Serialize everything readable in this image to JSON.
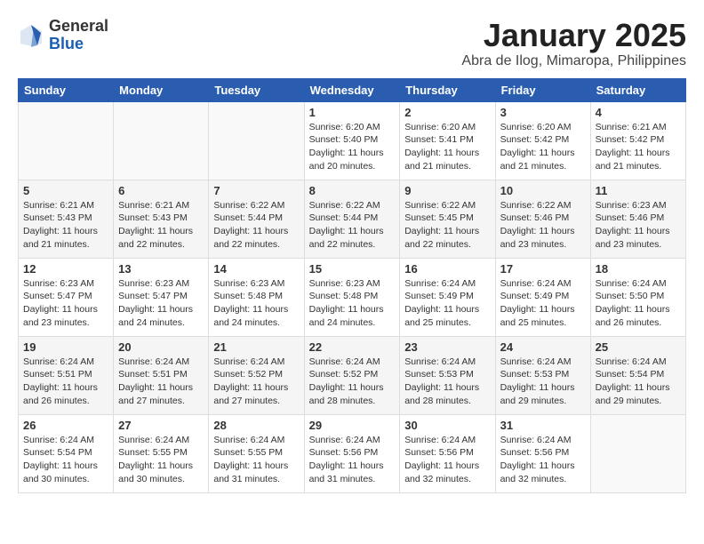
{
  "logo": {
    "general": "General",
    "blue": "Blue"
  },
  "title": "January 2025",
  "subtitle": "Abra de Ilog, Mimaropa, Philippines",
  "days_of_week": [
    "Sunday",
    "Monday",
    "Tuesday",
    "Wednesday",
    "Thursday",
    "Friday",
    "Saturday"
  ],
  "weeks": [
    [
      {
        "day": "",
        "sunrise": "",
        "sunset": "",
        "daylight": ""
      },
      {
        "day": "",
        "sunrise": "",
        "sunset": "",
        "daylight": ""
      },
      {
        "day": "",
        "sunrise": "",
        "sunset": "",
        "daylight": ""
      },
      {
        "day": "1",
        "sunrise": "Sunrise: 6:20 AM",
        "sunset": "Sunset: 5:40 PM",
        "daylight": "Daylight: 11 hours and 20 minutes."
      },
      {
        "day": "2",
        "sunrise": "Sunrise: 6:20 AM",
        "sunset": "Sunset: 5:41 PM",
        "daylight": "Daylight: 11 hours and 21 minutes."
      },
      {
        "day": "3",
        "sunrise": "Sunrise: 6:20 AM",
        "sunset": "Sunset: 5:42 PM",
        "daylight": "Daylight: 11 hours and 21 minutes."
      },
      {
        "day": "4",
        "sunrise": "Sunrise: 6:21 AM",
        "sunset": "Sunset: 5:42 PM",
        "daylight": "Daylight: 11 hours and 21 minutes."
      }
    ],
    [
      {
        "day": "5",
        "sunrise": "Sunrise: 6:21 AM",
        "sunset": "Sunset: 5:43 PM",
        "daylight": "Daylight: 11 hours and 21 minutes."
      },
      {
        "day": "6",
        "sunrise": "Sunrise: 6:21 AM",
        "sunset": "Sunset: 5:43 PM",
        "daylight": "Daylight: 11 hours and 22 minutes."
      },
      {
        "day": "7",
        "sunrise": "Sunrise: 6:22 AM",
        "sunset": "Sunset: 5:44 PM",
        "daylight": "Daylight: 11 hours and 22 minutes."
      },
      {
        "day": "8",
        "sunrise": "Sunrise: 6:22 AM",
        "sunset": "Sunset: 5:44 PM",
        "daylight": "Daylight: 11 hours and 22 minutes."
      },
      {
        "day": "9",
        "sunrise": "Sunrise: 6:22 AM",
        "sunset": "Sunset: 5:45 PM",
        "daylight": "Daylight: 11 hours and 22 minutes."
      },
      {
        "day": "10",
        "sunrise": "Sunrise: 6:22 AM",
        "sunset": "Sunset: 5:46 PM",
        "daylight": "Daylight: 11 hours and 23 minutes."
      },
      {
        "day": "11",
        "sunrise": "Sunrise: 6:23 AM",
        "sunset": "Sunset: 5:46 PM",
        "daylight": "Daylight: 11 hours and 23 minutes."
      }
    ],
    [
      {
        "day": "12",
        "sunrise": "Sunrise: 6:23 AM",
        "sunset": "Sunset: 5:47 PM",
        "daylight": "Daylight: 11 hours and 23 minutes."
      },
      {
        "day": "13",
        "sunrise": "Sunrise: 6:23 AM",
        "sunset": "Sunset: 5:47 PM",
        "daylight": "Daylight: 11 hours and 24 minutes."
      },
      {
        "day": "14",
        "sunrise": "Sunrise: 6:23 AM",
        "sunset": "Sunset: 5:48 PM",
        "daylight": "Daylight: 11 hours and 24 minutes."
      },
      {
        "day": "15",
        "sunrise": "Sunrise: 6:23 AM",
        "sunset": "Sunset: 5:48 PM",
        "daylight": "Daylight: 11 hours and 24 minutes."
      },
      {
        "day": "16",
        "sunrise": "Sunrise: 6:24 AM",
        "sunset": "Sunset: 5:49 PM",
        "daylight": "Daylight: 11 hours and 25 minutes."
      },
      {
        "day": "17",
        "sunrise": "Sunrise: 6:24 AM",
        "sunset": "Sunset: 5:49 PM",
        "daylight": "Daylight: 11 hours and 25 minutes."
      },
      {
        "day": "18",
        "sunrise": "Sunrise: 6:24 AM",
        "sunset": "Sunset: 5:50 PM",
        "daylight": "Daylight: 11 hours and 26 minutes."
      }
    ],
    [
      {
        "day": "19",
        "sunrise": "Sunrise: 6:24 AM",
        "sunset": "Sunset: 5:51 PM",
        "daylight": "Daylight: 11 hours and 26 minutes."
      },
      {
        "day": "20",
        "sunrise": "Sunrise: 6:24 AM",
        "sunset": "Sunset: 5:51 PM",
        "daylight": "Daylight: 11 hours and 27 minutes."
      },
      {
        "day": "21",
        "sunrise": "Sunrise: 6:24 AM",
        "sunset": "Sunset: 5:52 PM",
        "daylight": "Daylight: 11 hours and 27 minutes."
      },
      {
        "day": "22",
        "sunrise": "Sunrise: 6:24 AM",
        "sunset": "Sunset: 5:52 PM",
        "daylight": "Daylight: 11 hours and 28 minutes."
      },
      {
        "day": "23",
        "sunrise": "Sunrise: 6:24 AM",
        "sunset": "Sunset: 5:53 PM",
        "daylight": "Daylight: 11 hours and 28 minutes."
      },
      {
        "day": "24",
        "sunrise": "Sunrise: 6:24 AM",
        "sunset": "Sunset: 5:53 PM",
        "daylight": "Daylight: 11 hours and 29 minutes."
      },
      {
        "day": "25",
        "sunrise": "Sunrise: 6:24 AM",
        "sunset": "Sunset: 5:54 PM",
        "daylight": "Daylight: 11 hours and 29 minutes."
      }
    ],
    [
      {
        "day": "26",
        "sunrise": "Sunrise: 6:24 AM",
        "sunset": "Sunset: 5:54 PM",
        "daylight": "Daylight: 11 hours and 30 minutes."
      },
      {
        "day": "27",
        "sunrise": "Sunrise: 6:24 AM",
        "sunset": "Sunset: 5:55 PM",
        "daylight": "Daylight: 11 hours and 30 minutes."
      },
      {
        "day": "28",
        "sunrise": "Sunrise: 6:24 AM",
        "sunset": "Sunset: 5:55 PM",
        "daylight": "Daylight: 11 hours and 31 minutes."
      },
      {
        "day": "29",
        "sunrise": "Sunrise: 6:24 AM",
        "sunset": "Sunset: 5:56 PM",
        "daylight": "Daylight: 11 hours and 31 minutes."
      },
      {
        "day": "30",
        "sunrise": "Sunrise: 6:24 AM",
        "sunset": "Sunset: 5:56 PM",
        "daylight": "Daylight: 11 hours and 32 minutes."
      },
      {
        "day": "31",
        "sunrise": "Sunrise: 6:24 AM",
        "sunset": "Sunset: 5:56 PM",
        "daylight": "Daylight: 11 hours and 32 minutes."
      },
      {
        "day": "",
        "sunrise": "",
        "sunset": "",
        "daylight": ""
      }
    ]
  ]
}
